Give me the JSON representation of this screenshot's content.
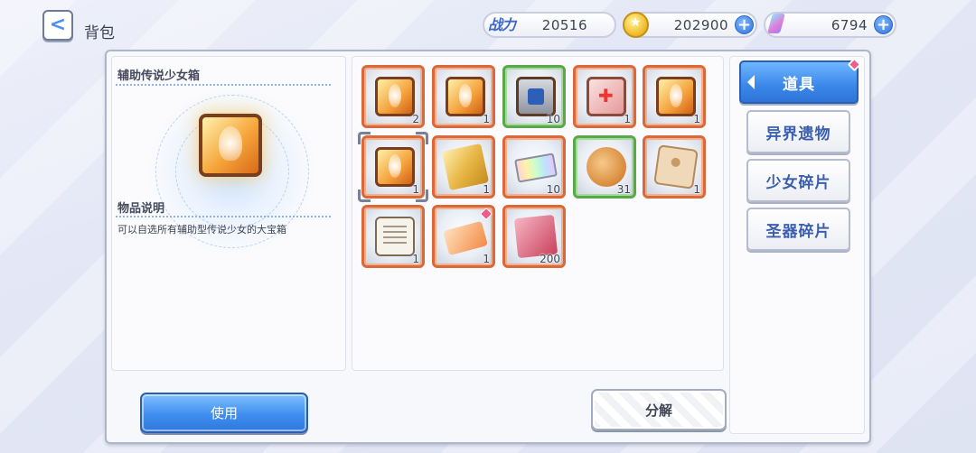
{
  "header": {
    "title": "背包",
    "power_label": "战力",
    "power_value": "20516",
    "gold_value": "202900",
    "gem_value": "6794"
  },
  "detail": {
    "item_name": "辅助传说少女箱",
    "desc_title": "物品说明",
    "desc_text": "可以自选所有辅助型传说少女的大宝箱"
  },
  "items": [
    {
      "icon": "legend-box-icon",
      "qty": "2"
    },
    {
      "icon": "legend-box-icon",
      "qty": "1"
    },
    {
      "icon": "treasure-chest-icon",
      "qty": "10"
    },
    {
      "icon": "medkit-box-icon",
      "qty": "1"
    },
    {
      "icon": "legend-box-icon",
      "qty": "1"
    },
    {
      "icon": "legend-box-icon",
      "qty": "1"
    },
    {
      "icon": "gold-card-icon",
      "qty": "1"
    },
    {
      "icon": "rainbow-ticket-icon",
      "qty": "10"
    },
    {
      "icon": "cookie-icon",
      "qty": "31"
    },
    {
      "icon": "envelope-icon",
      "qty": "1"
    },
    {
      "icon": "document-icon",
      "qty": "1"
    },
    {
      "icon": "ticket-icon",
      "qty": "1"
    },
    {
      "icon": "scroll-icon",
      "qty": "200"
    }
  ],
  "buttons": {
    "use": "使用",
    "split": "分解"
  },
  "tabs": [
    "道具",
    "异界遗物",
    "少女碎片",
    "圣器碎片"
  ],
  "colors": {
    "accent_blue": "#3a87ea",
    "slot_orange": "#d9683a",
    "slot_green": "#59a84a",
    "badge_pink": "#f25a8a"
  }
}
